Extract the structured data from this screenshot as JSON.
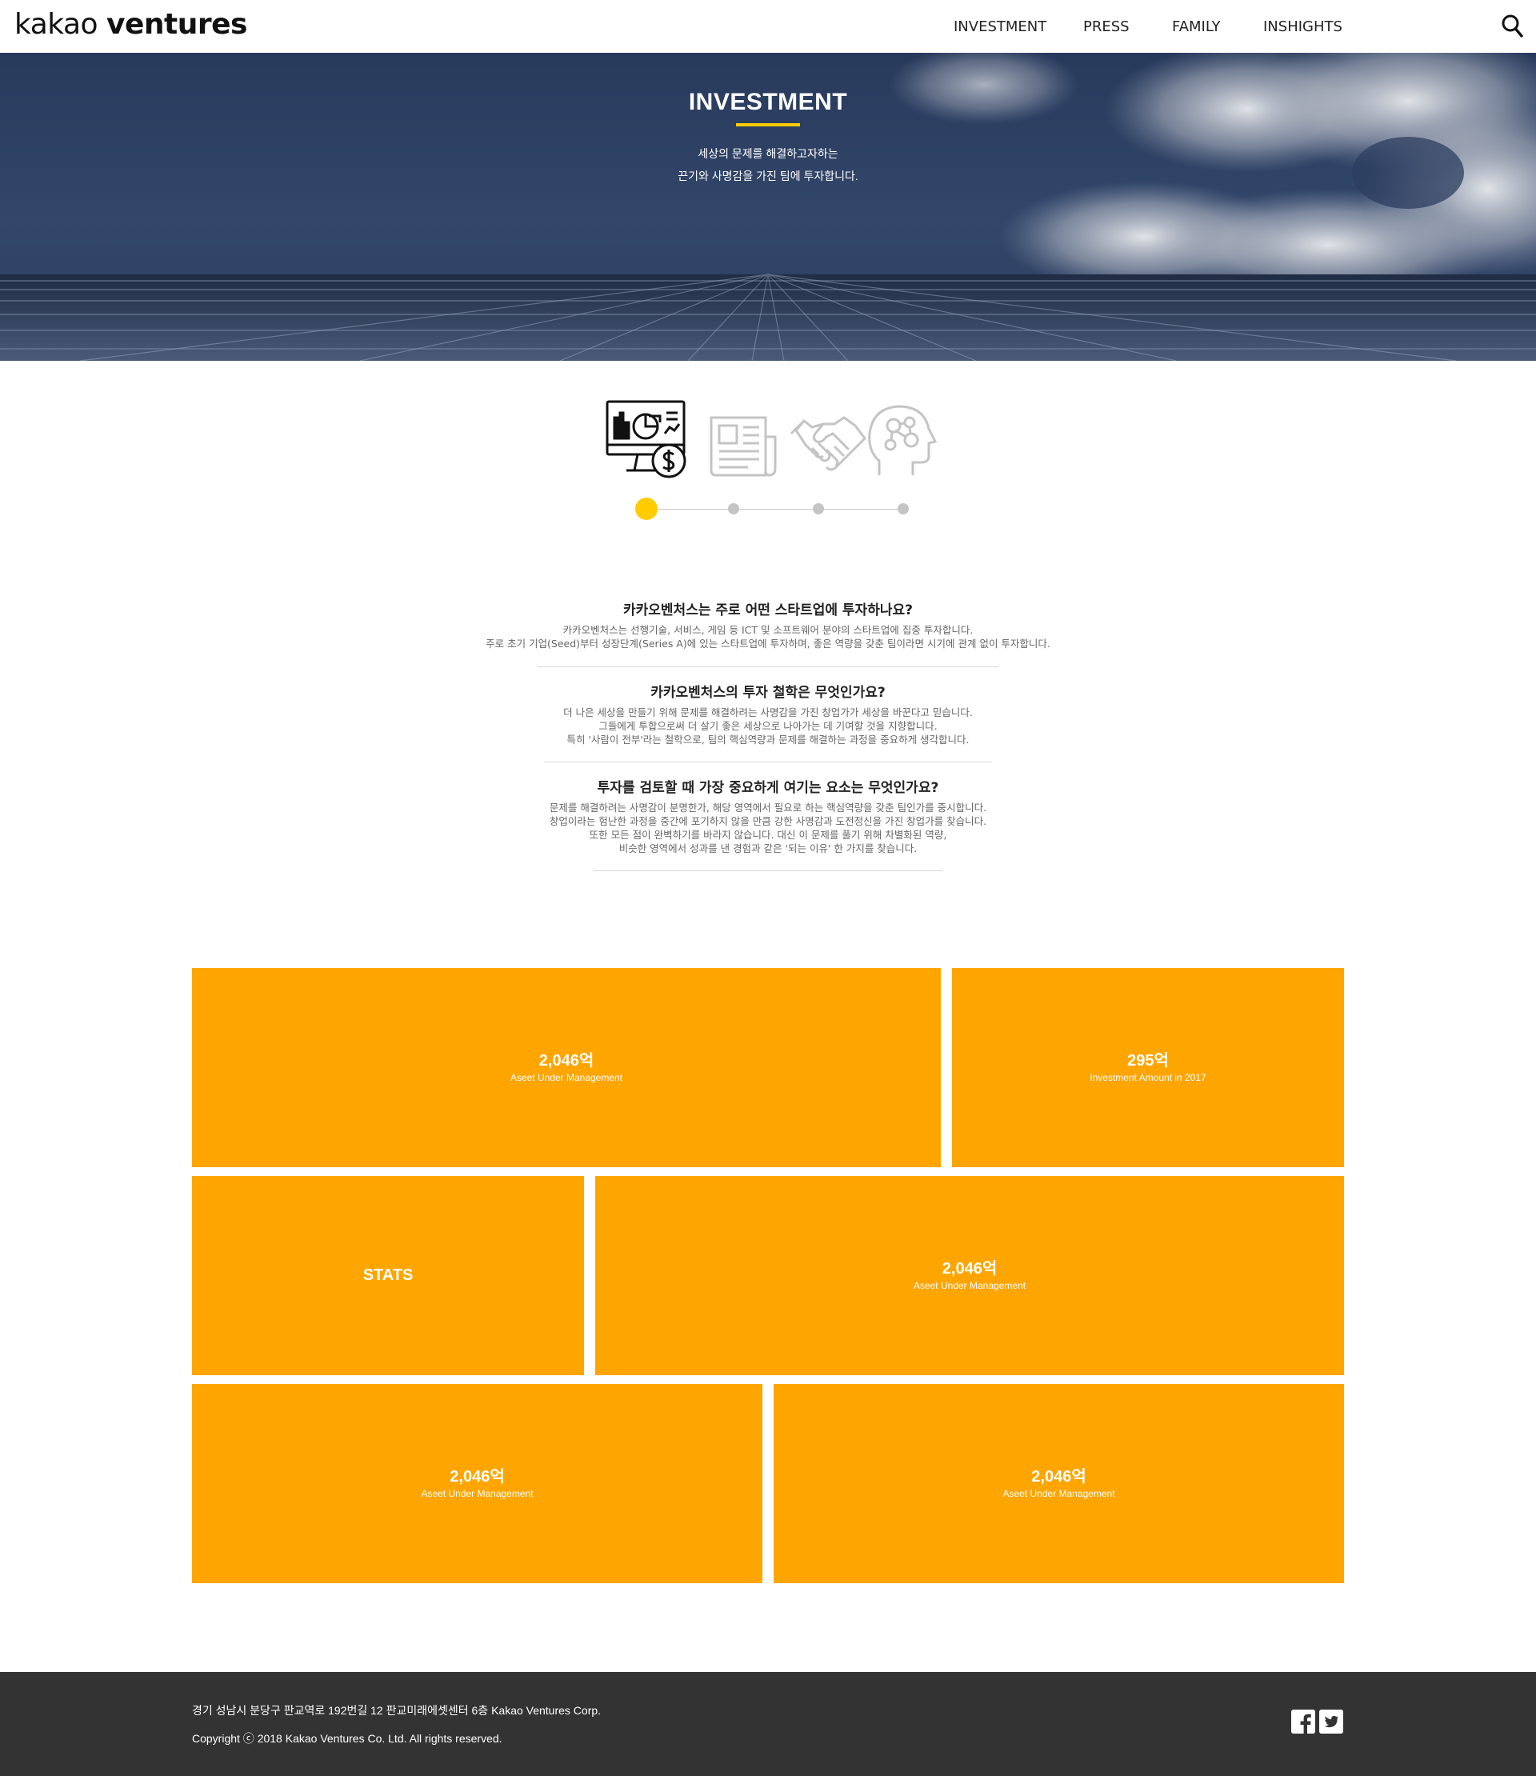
{
  "header": {
    "logo_light": "kakao",
    "logo_bold": "ventures",
    "nav": [
      "INVESTMENT",
      "PRESS",
      "FAMILY",
      "INSHIGHTS"
    ]
  },
  "hero": {
    "title": "INVESTMENT",
    "subtitle_line1": "세상의 문제를 해결하고자하는",
    "subtitle_line2": "끈기와 사명감을 가진 팀에 투자합니다."
  },
  "steps": {
    "icons": [
      "monitor-chart-dollar-icon",
      "document-icon",
      "handshake-icon",
      "head-network-icon"
    ],
    "active_index": 0
  },
  "faq": [
    {
      "question": "카카오벤처스는 주로 어떤 스타트업에 투자하나요?",
      "answer": [
        "카카오벤처스는 선행기술, 서비스, 게임 등 ICT 및 소프트웨어 분야의 스타트업에 집중 투자합니다.",
        "주로 초기 기업(Seed)부터 성장단계(Series A)에 있는 스타트업에 투자하며, 좋은 역량을 갖춘 팀이라면 시기에 관계 없이 투자합니다."
      ]
    },
    {
      "question": "카카오벤처스의 투자 철학은 무엇인가요?",
      "answer": [
        "더 나은 세상을 만들기 위해 문제를 해결하려는 사명감을 가진 창업가가 세상을 바꾼다고 믿습니다.",
        "그들에게 투합으로써 더 살기 좋은 세상으로 나아가는 데 기여할 것을 지향합니다.",
        "특히 '사람이 전부'라는 철학으로, 팀의 핵심역량과 문제를 해결하는 과정을 중요하게 생각합니다."
      ]
    },
    {
      "question": "투자를 검토할 때 가장 중요하게 여기는 요소는 무엇인가요?",
      "answer": [
        "문제를 해결하려는 사명감이 분명한가, 해당 영역에서 필요로 하는 핵심역량을 갖춘 팀인가를 중시합니다.",
        "창업이라는 험난한 과정을 중간에 포기하지 않을 만큼 강한 사명감과 도전정신을 가진 창업가를 찾습니다.",
        "또한 모든 점이 완벽하기를 바라지 않습니다. 대신 이 문제를 풀기 위해 차별화된 역량,",
        "비슷한 영역에서 성과를 낸 경험과 같은 '되는 이유' 한 가지를 찾습니다."
      ]
    }
  ],
  "stats": {
    "tile1": {
      "value": "2,046억",
      "label": "Aseet Under Management"
    },
    "tile2": {
      "value": "295억",
      "label": "Investment Amount in 2017"
    },
    "tile3": {
      "title": "STATS"
    },
    "tile4": {
      "value": "2,046억",
      "label": "Aseet Under Management"
    },
    "tile5": {
      "value": "2,046억",
      "label": "Aseet Under Management"
    },
    "tile6": {
      "value": "2,046억",
      "label": "Aseet Under Management"
    }
  },
  "footer": {
    "address": "경기 성남시 분당구 판교역로 192번길 12 판교미래에셋센터 6층 Kakao Ventures Corp.",
    "copyright": "Copyright ⓒ 2018 Kakao Ventures Co. Ltd. All rights reserved.",
    "social": [
      "facebook-icon",
      "twitter-icon"
    ]
  },
  "colors": {
    "accent": "#ffcc00",
    "tile": "#ffa500",
    "footer_bg": "#333333",
    "hero_bg": "#2f4266"
  }
}
